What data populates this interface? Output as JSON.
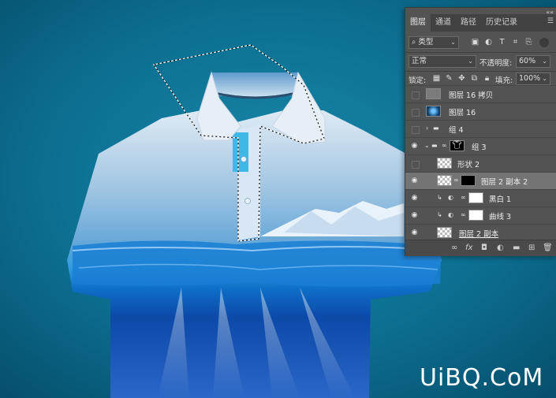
{
  "colors": {
    "background": "#0b6f91",
    "panel": "#535353",
    "panel_dark": "#424242",
    "selected_row": "#747474"
  },
  "panel": {
    "collapse_glyph": "««",
    "tabs": [
      {
        "label": "图层",
        "active": true
      },
      {
        "label": "通道",
        "active": false
      },
      {
        "label": "路径",
        "active": false
      },
      {
        "label": "历史记录",
        "active": false
      }
    ],
    "menu_icon": "☰",
    "filter": {
      "icon": "search-icon",
      "value": "类型"
    },
    "blend_mode": "正常",
    "opacity_label": "不透明度:",
    "opacity_value": "60%",
    "lock_label": "锁定:",
    "fill_label": "填充:",
    "fill_value": "100%",
    "layers": [
      {
        "name": "图层 16 拷贝",
        "visible": false
      },
      {
        "name": "图层 16",
        "visible": false
      },
      {
        "name": "组 4",
        "visible": false
      },
      {
        "name": "组 3",
        "visible": true
      },
      {
        "name": "形状 2",
        "visible": false
      },
      {
        "name": "图层 2 副本 2",
        "visible": true,
        "selected": true
      },
      {
        "name": "黑白 1",
        "visible": true
      },
      {
        "name": "曲线 3",
        "visible": true
      },
      {
        "name": "图层 2 副本",
        "visible": true
      }
    ],
    "bottom_icons": [
      "link-icon",
      "fx-icon",
      "mask-icon",
      "adjustment-icon",
      "folder-icon",
      "new-layer-icon",
      "trash-icon"
    ]
  },
  "watermark": "UiBQ.CoM"
}
